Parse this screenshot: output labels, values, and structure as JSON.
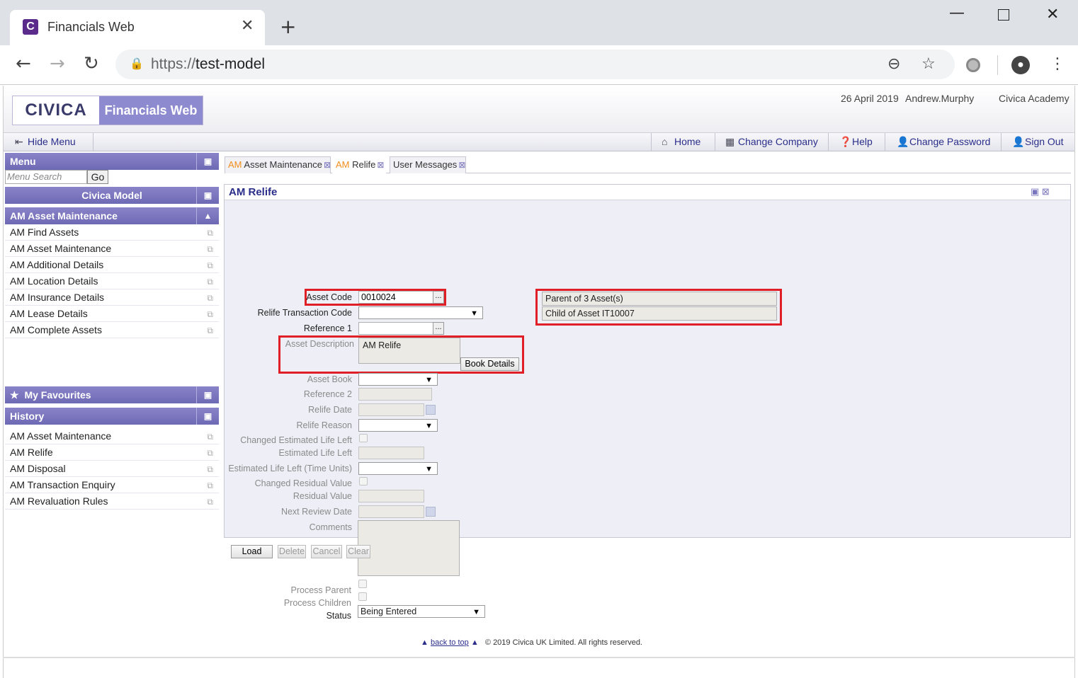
{
  "browser": {
    "tab_title": "Financials Web",
    "tab_favicon_letter": "C",
    "url_scheme": "https://",
    "url_host": "test-model"
  },
  "header": {
    "logo_civica": "CIVICA",
    "logo_product": "Financials Web",
    "date": "26 April 2019",
    "user": "Andrew.Murphy",
    "company": "Civica Academy"
  },
  "menubar": {
    "hide_menu": "Hide Menu",
    "home": "Home",
    "change_company": "Change Company",
    "help": "Help",
    "change_password": "Change Password",
    "sign_out": "Sign Out"
  },
  "sidebar": {
    "menu_title": "Menu",
    "search_placeholder": "Menu Search",
    "go": "Go",
    "model_title": "Civica Model",
    "section_title": "AM Asset Maintenance",
    "items": [
      "AM Find Assets",
      "AM Asset Maintenance",
      "AM Additional Details",
      "AM Location Details",
      "AM Insurance Details",
      "AM Lease Details",
      "AM Complete Assets"
    ],
    "favourites_title": "My Favourites",
    "history_title": "History",
    "history": [
      "AM Asset Maintenance",
      "AM Relife",
      "AM Disposal",
      "AM Transaction Enquiry",
      "AM Revaluation Rules"
    ]
  },
  "tabs": [
    {
      "prefix": "AM",
      "label": "Asset Maintenance"
    },
    {
      "prefix": "AM",
      "label": "Relife"
    },
    {
      "prefix": "",
      "label": "User Messages"
    }
  ],
  "form": {
    "title": "AM Relife",
    "asset_code_label": "Asset Code",
    "asset_code_value": "0010024",
    "relife_transaction_code_label": "Relife Transaction Code",
    "reference1_label": "Reference 1",
    "asset_description_label": "Asset Description",
    "asset_description_value": "AM Relife",
    "book_details": "Book Details",
    "asset_book_label": "Asset Book",
    "reference2_label": "Reference 2",
    "relife_date_label": "Relife Date",
    "relife_reason_label": "Relife Reason",
    "changed_est_life_left_label": "Changed Estimated Life Left",
    "est_life_left_label": "Estimated Life Left",
    "est_life_left_units_label": "Estimated Life Left (Time Units)",
    "changed_residual_value_label": "Changed Residual Value",
    "residual_value_label": "Residual Value",
    "next_review_date_label": "Next Review Date",
    "comments_label": "Comments",
    "process_parent_label": "Process Parent",
    "process_children_label": "Process Children",
    "status_label": "Status",
    "status_value": "Being Entered",
    "parent_info": "Parent of 3 Asset(s)",
    "child_info": "Child of Asset IT10007",
    "lookup": "..."
  },
  "buttons": {
    "load": "Load",
    "delete": "Delete",
    "cancel": "Cancel",
    "clear": "Clear"
  },
  "footer": {
    "back_to_top": "back to top",
    "copyright": "© 2019 Civica UK Limited. All rights reserved."
  },
  "colors": {
    "brand_purple": "#8e8ad0",
    "highlight_red": "#e01e26",
    "am_orange": "#f28e1c"
  }
}
